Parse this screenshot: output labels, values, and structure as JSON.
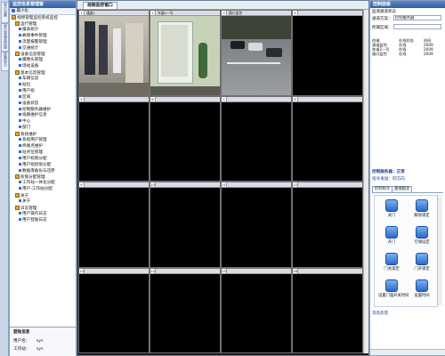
{
  "left_strip": {
    "tabs": [
      "显示设备",
      "显示视频监控操作",
      "按需显示"
    ]
  },
  "left_panel": {
    "title": "监控信息管理窗",
    "toolbar": {
      "label": "最小化"
    },
    "tree": [
      "视频管理监控系统监控",
      "运行管理",
      "报表统计",
      "故障事件管理",
      "流量报警管理",
      "交通统计",
      "设备信息管理",
      "摄像头管理",
      "场站设备",
      "基本信息管理",
      "车辆信息",
      "站位",
      "用户组",
      "区域",
      "设备状态",
      "控制服务器维护",
      "线路维护信息",
      "中心",
      "部门",
      "系统维护",
      "系统用户管理",
      "终端点维护",
      "站点位管理",
      "用户权限分配",
      "用户组权限分配",
      "数据库备份与还原",
      "权限分配管理",
      "工作站一体化分配",
      "用户-工作站分配",
      "关于",
      "关于",
      "日志管理",
      "用户操作日志",
      "用户登陆日志"
    ],
    "info": {
      "title": "登陆信息",
      "user_label": "用户名：",
      "user_value": "sys",
      "ws_label": "工作站：",
      "ws_value": "sys"
    }
  },
  "center": {
    "tab_label": "视频监控窗口",
    "cells": [
      {
        "num": "1",
        "name": "通道1"
      },
      {
        "num": "2",
        "name": "车道2一号"
      },
      {
        "num": "3",
        "name": "路口监控"
      },
      {
        "num": "4",
        "name": ""
      },
      {
        "num": "5",
        "name": ""
      },
      {
        "num": "6",
        "name": ""
      },
      {
        "num": "7",
        "name": ""
      },
      {
        "num": "8",
        "name": ""
      },
      {
        "num": "9",
        "name": ""
      },
      {
        "num": "10",
        "name": ""
      },
      {
        "num": "11",
        "name": ""
      },
      {
        "num": "12",
        "name": ""
      },
      {
        "num": "13",
        "name": ""
      },
      {
        "num": "14",
        "name": ""
      },
      {
        "num": "15",
        "name": ""
      },
      {
        "num": "16",
        "name": ""
      }
    ]
  },
  "right_panel": {
    "title": "控制面板",
    "subtitle": "监测通道状态",
    "fields": [
      {
        "label": "通道方案：",
        "value": "控制服务器"
      },
      {
        "label": "所属区域：",
        "value": ""
      }
    ],
    "table_header": [
      "终端",
      "在线状态",
      "时间"
    ],
    "table_rows": [
      [
        "通道监控",
        "在线",
        "2009"
      ],
      [
        "车道2一号",
        "在线",
        "2009"
      ],
      [
        "路口监控",
        "在线",
        "2009"
      ]
    ],
    "server_status": "控制服务器：正常",
    "direction_label": "指令发送：同方向",
    "ctrl_tabs": [
      "控制指令",
      "查询指令"
    ],
    "buttons": [
      "关门",
      "解除锁定",
      "开门",
      "空调设定",
      "门关锁定",
      "门开锁定",
      "设置门强开关时间",
      "设置时间"
    ],
    "footer": "消息反馈"
  }
}
